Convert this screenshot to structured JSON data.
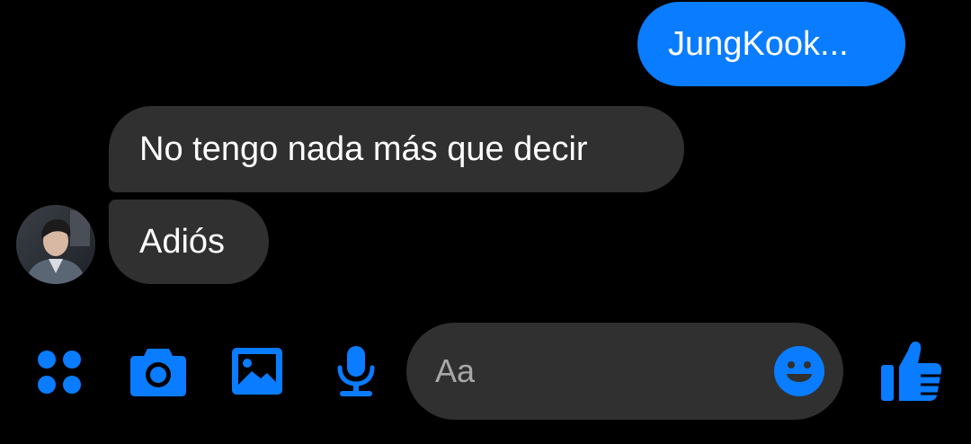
{
  "messages": [
    {
      "direction": "sent",
      "text": "JungKook..."
    },
    {
      "direction": "received",
      "text": "No tengo nada más que decir"
    },
    {
      "direction": "received",
      "text": "Adiós"
    }
  ],
  "composer": {
    "placeholder": "Aa"
  },
  "toolbar": {
    "icons": [
      "more-apps-icon",
      "camera-icon",
      "gallery-icon",
      "microphone-icon",
      "emoji-icon",
      "thumbs-up-icon"
    ]
  },
  "colors": {
    "background": "#000000",
    "accent": "#0a7cff",
    "received_bubble": "#303030",
    "composer_bg": "#303030",
    "placeholder": "#a8a8a8"
  }
}
